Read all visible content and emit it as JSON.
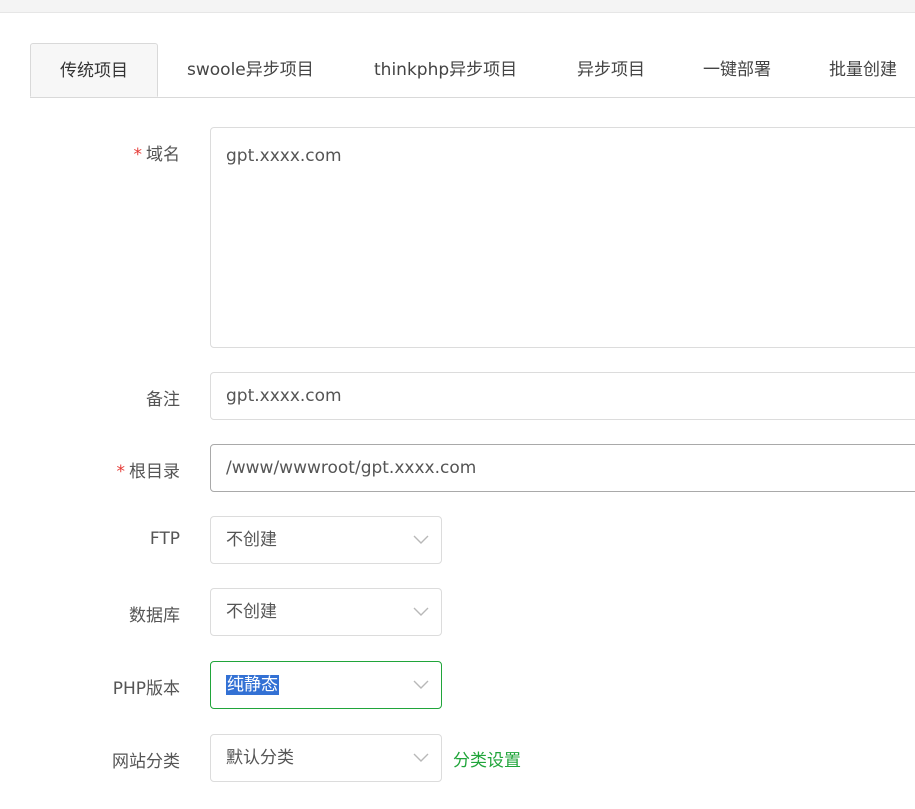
{
  "tabs": [
    {
      "label": "传统项目"
    },
    {
      "label": "swoole异步项目"
    },
    {
      "label": "thinkphp异步项目"
    },
    {
      "label": "异步项目"
    },
    {
      "label": "一键部署"
    },
    {
      "label": "批量创建"
    }
  ],
  "form": {
    "required_mark": "*",
    "domain": {
      "label": "域名",
      "value": "gpt.xxxx.com"
    },
    "remark": {
      "label": "备注",
      "value": "gpt.xxxx.com"
    },
    "root": {
      "label": "根目录",
      "value": "/www/wwwroot/gpt.xxxx.com"
    },
    "ftp": {
      "label": "FTP",
      "value": "不创建"
    },
    "database": {
      "label": "数据库",
      "value": "不创建"
    },
    "php": {
      "label": "PHP版本",
      "value": "纯静态"
    },
    "category": {
      "label": "网站分类",
      "value": "默认分类",
      "settings_link": "分类设置"
    }
  },
  "colors": {
    "accent_green": "#20a53a",
    "required_red": "#e53935",
    "selection_blue": "#3371d4"
  },
  "icons": {
    "select_arrow": "chevron-down-icon"
  }
}
